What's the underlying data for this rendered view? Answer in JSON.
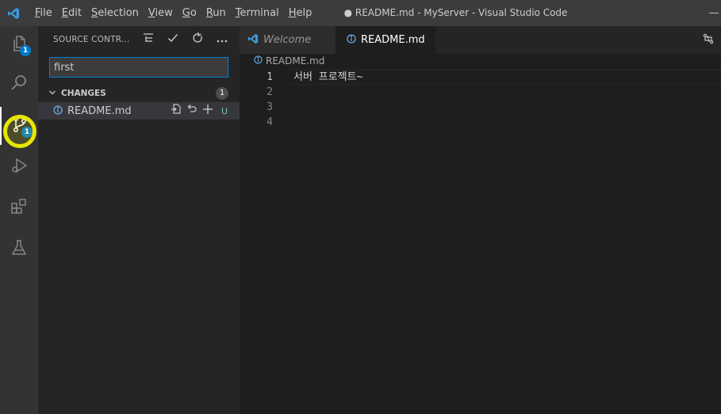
{
  "window": {
    "title": "● README.md - MyServer - Visual Studio Code",
    "minimize": "—"
  },
  "menu": [
    {
      "underline": "F",
      "rest": "ile"
    },
    {
      "underline": "E",
      "rest": "dit"
    },
    {
      "underline": "S",
      "rest": "election"
    },
    {
      "underline": "V",
      "rest": "iew"
    },
    {
      "underline": "G",
      "rest": "o"
    },
    {
      "underline": "R",
      "rest": "un"
    },
    {
      "underline": "T",
      "rest": "erminal"
    },
    {
      "underline": "H",
      "rest": "elp"
    }
  ],
  "activity": {
    "explorer_badge": "1",
    "scm_badge": "1"
  },
  "sidebar": {
    "title": "SOURCE CONTR...",
    "commit_message": "first",
    "changes_label": "CHANGES",
    "changes_count": "1",
    "file": {
      "name": "README.md",
      "status": "U"
    }
  },
  "tabs": [
    {
      "label": "Welcome",
      "active": false
    },
    {
      "label": "README.md",
      "active": true
    }
  ],
  "breadcrumb": "README.md",
  "editor": {
    "lines": [
      {
        "number": "1",
        "text": "서버 프로젝트~"
      },
      {
        "number": "2",
        "text": ""
      },
      {
        "number": "3",
        "text": ""
      },
      {
        "number": "4",
        "text": ""
      }
    ]
  },
  "colors": {
    "accent": "#007acc",
    "highlight_ring": "#e6e600",
    "untracked": "#73c991"
  }
}
